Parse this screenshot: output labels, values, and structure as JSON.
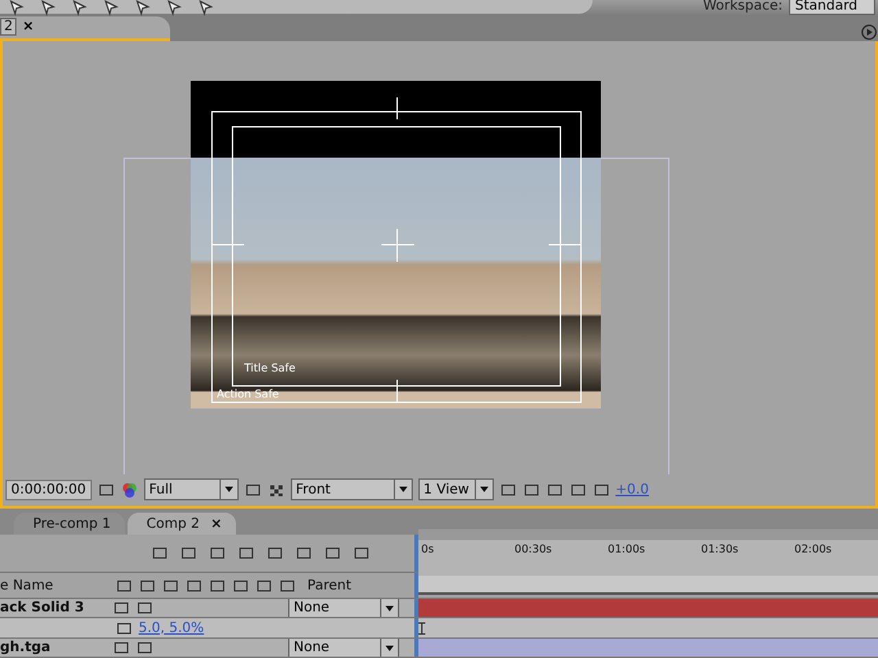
{
  "toolbar": {
    "workspace_label": "Workspace:",
    "workspace": "Standard"
  },
  "comp_panel": {
    "tab": "2",
    "close": "×",
    "title_safe": "Title Safe",
    "action_safe": "Action Safe"
  },
  "viewer_bar": {
    "timecode": "0:00:00:00",
    "resolution": "Full",
    "view": "Front",
    "layout": "1 View",
    "exposure": "+0.0"
  },
  "timeline": {
    "tab_close": "×",
    "tabs": [
      {
        "label": "Pre-comp 1",
        "selected": false
      },
      {
        "label": "Comp 2",
        "selected": true
      }
    ],
    "ruler": [
      "0s",
      "00:30s",
      "01:00s",
      "01:30s",
      "02:00s"
    ],
    "columns": {
      "name": "e Name",
      "parent": "Parent"
    },
    "layers": [
      {
        "kind": "layer",
        "name": "ack Solid 3",
        "parent": "None",
        "color": "#b23a3a"
      },
      {
        "kind": "property",
        "value": "5.0, 5.0%"
      },
      {
        "kind": "layer",
        "name": "gh.tga",
        "parent": "None",
        "color": "#a9a9d6"
      }
    ]
  }
}
